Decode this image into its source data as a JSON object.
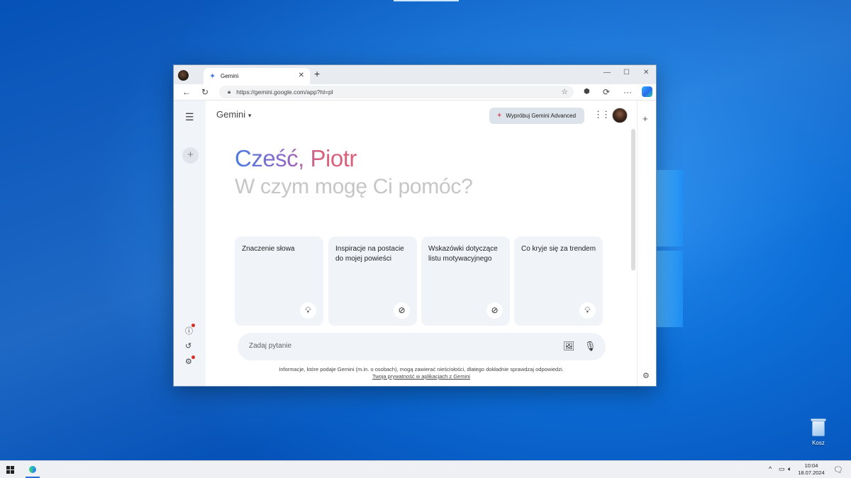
{
  "browser": {
    "tab_title": "Gemini",
    "url": "https://gemini.google.com/app?hl=pl",
    "icons": [
      "profile-icon",
      "gemini-spark-icon",
      "close-icon",
      "new-tab-icon",
      "minimize-icon",
      "maximize-icon",
      "close-window-icon",
      "back-icon",
      "refresh-icon",
      "lock-icon",
      "star-icon",
      "extension-icon",
      "sync-icon",
      "more-icon",
      "copilot-icon"
    ]
  },
  "gemini": {
    "app_name": "Gemini",
    "advanced_button": "Wypróbuj Gemini Advanced",
    "greeting": "Cześć, Piotr",
    "subtitle": "W czym mogę Ci pomóc?",
    "cards": [
      {
        "text": "Znaczenie słowa",
        "icon": "lightbulb-icon"
      },
      {
        "text": "Inspiracje na postacie do mojej powieści",
        "icon": "compass-icon"
      },
      {
        "text": "Wskazówki dotyczące listu motywacyjnego",
        "icon": "compass-icon"
      },
      {
        "text": "Co kryje się za trendem",
        "icon": "lightbulb-icon"
      }
    ],
    "prompt_placeholder": "Zadaj pytanie",
    "disclaimer": "Informacje, które podaje Gemini (m.in. o osobach), mogą zawierać nieścisłości, dlatego dokładnie sprawdzaj odpowiedzi.",
    "privacy_link": "Twoja prywatność w aplikacjach z Gemini"
  },
  "desktop": {
    "recycle_bin_label": "Kosz"
  },
  "taskbar": {
    "time": "10:04",
    "date": "18.07.2024"
  },
  "colors": {
    "desktop_blue": "#0d6fd8",
    "gemini_gradient_start": "#4a7ae0",
    "gemini_gradient_end": "#d9607a",
    "card_bg": "#f0f4f9"
  }
}
